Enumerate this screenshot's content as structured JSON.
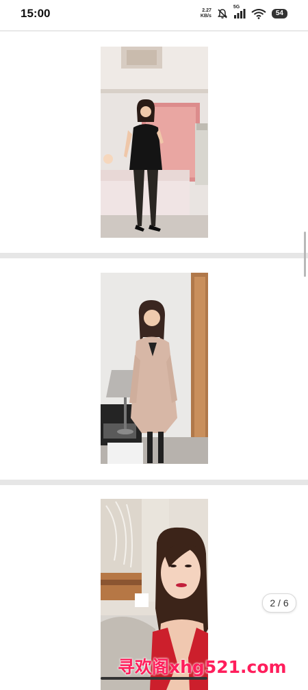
{
  "status_bar": {
    "time": "15:00",
    "net_speed_value": "2.27",
    "net_speed_unit": "KB/s",
    "network_type": "5G",
    "battery": "54",
    "icons": [
      "mute-bell-icon",
      "cellular-signal-icon",
      "wifi-icon",
      "battery-icon"
    ]
  },
  "gallery": {
    "photos": [
      {
        "name": "photo-1",
        "description_icon": "woman-black-dress-photo"
      },
      {
        "name": "photo-2",
        "description_icon": "woman-beige-trench-coat-photo"
      },
      {
        "name": "photo-3",
        "description_icon": "woman-red-top-selfie-photo"
      }
    ],
    "page_indicator": "2 / 6"
  },
  "watermark": {
    "text": "寻欢阁xhg521.com"
  },
  "colors": {
    "watermark": "#ff1e5c",
    "band": "#e6e6e6"
  }
}
